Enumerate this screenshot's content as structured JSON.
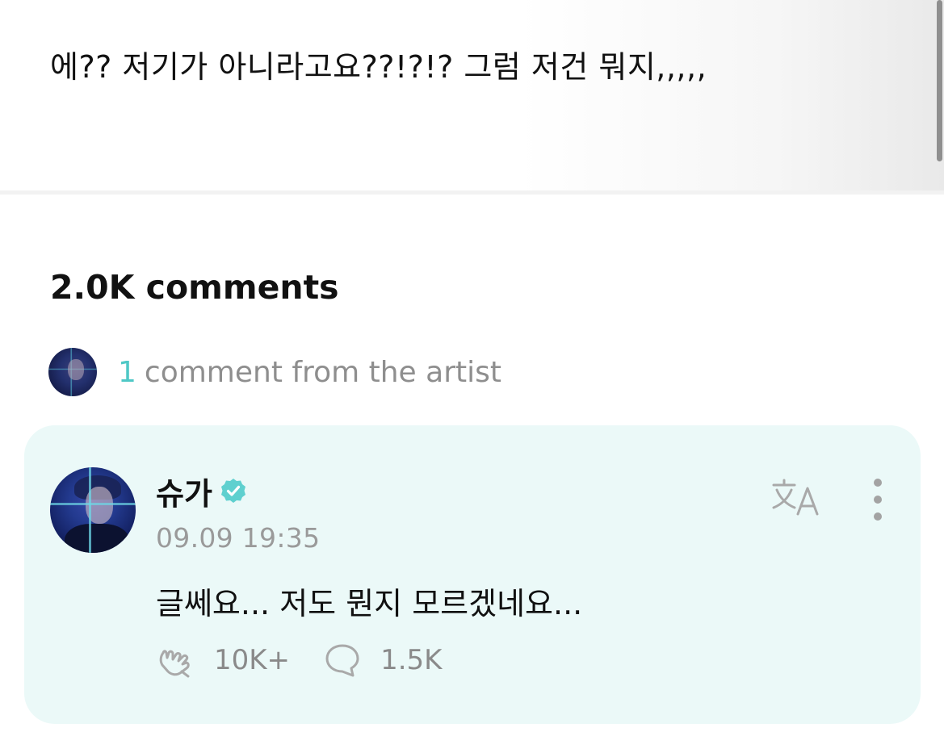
{
  "post": {
    "text": "에?? 저기가 아니라고요??!?!? 그럼 저건 뭐지,,,,,"
  },
  "comments_header": {
    "count_label": "2.0K comments"
  },
  "artist_comments": {
    "count": "1",
    "label": "comment from the artist"
  },
  "artist_comment": {
    "author": "슈가",
    "verified": true,
    "timestamp": "09.09 19:35",
    "text": "글쎄요... 저도 뭔지 모르겠네요...",
    "likes": "10K+",
    "replies": "1.5K"
  },
  "colors": {
    "accent": "#4fc8c6",
    "card_background": "#ebf9f8",
    "muted_text": "#8e8e8e"
  },
  "icons": {
    "verified": "verified-badge-icon",
    "translate": "translate-icon",
    "more": "more-vertical-icon",
    "like": "applause-icon",
    "reply": "speech-bubble-icon"
  }
}
